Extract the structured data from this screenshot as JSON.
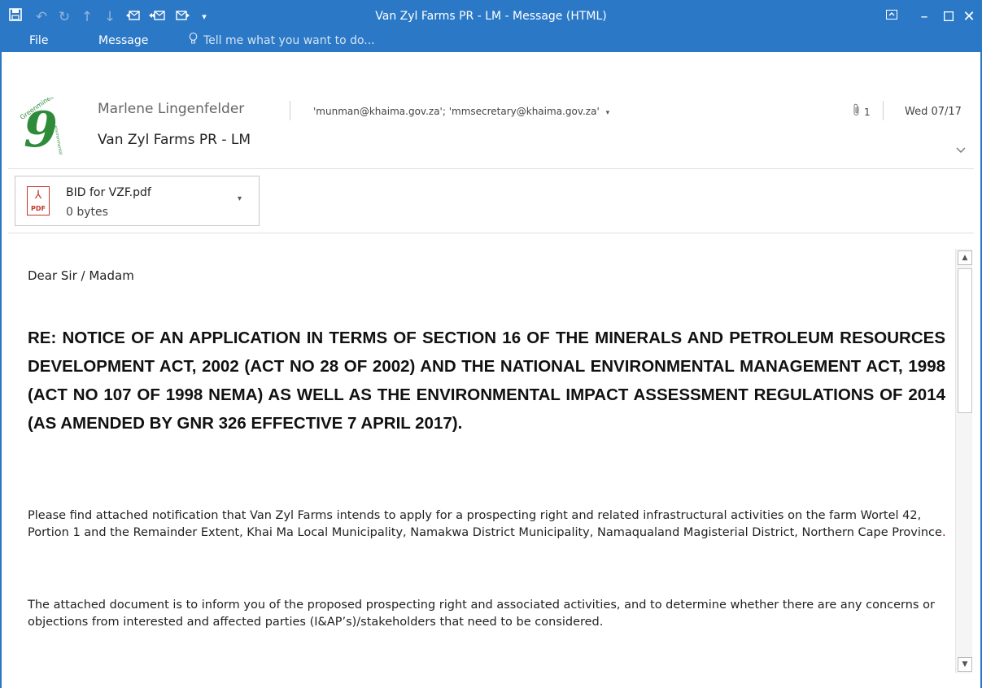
{
  "window": {
    "title": "Van Zyl Farms PR - LM - Message (HTML)"
  },
  "quick_access": {
    "icons": [
      "save-icon",
      "undo-icon",
      "redo-icon",
      "up-arrow-icon",
      "down-arrow-icon",
      "reply-icon",
      "reply-all-icon",
      "forward-icon",
      "customize-icon"
    ]
  },
  "menu": {
    "file": "File",
    "message": "Message",
    "tell_me": "Tell me what you want to do..."
  },
  "header": {
    "sender": "Marlene Lingenfelder",
    "recipients": "'munman@khaima.gov.za'; 'mmsecretary@khaima.gov.za'",
    "attachment_count": "1",
    "date": "Wed 07/17",
    "subject": "Van Zyl Farms PR - LM"
  },
  "attachment": {
    "name": "BID for VZF.pdf",
    "size": "0 bytes",
    "type_label": "PDF"
  },
  "body": {
    "salutation": "Dear Sir / Madam",
    "re_heading": "RE: NOTICE OF AN APPLICATION IN TERMS OF SECTION 16 OF THE MINERALS AND PETROLEUM RESOURCES DEVELOPMENT ACT, 2002 (ACT NO 28 OF 2002) AND THE NATIONAL ENVIRONMENTAL MANAGEMENT ACT, 1998 (ACT NO 107 OF 1998 NEMA) AS WELL AS THE ENVIRONMENTAL IMPACT ASSESSMENT REGULATIONS OF 2014 (AS AMENDED BY GNR 326 EFFECTIVE 7 APRIL 2017).",
    "paragraph1": "Please find attached notification that Van Zyl Farms intends to apply for a prospecting right and related infrastructural activities on the farm Wortel 42, Portion 1 and the Remainder Extent, Khai Ma Local Municipality, Namakwa District Municipality, Namaqualand Magisterial District, Northern Cape Province",
    "paragraph1_end": ".",
    "paragraph2": "The attached document is to inform you of the proposed prospecting  right and associated activities, and to determine whether there are any concerns or objections from interested and affected parties (I&AP’s)/stakeholders that need to be considered."
  },
  "colors": {
    "titlebar": "#2b78c6",
    "accent_red": "#cc0000",
    "logo_green": "#2e8b3a"
  }
}
